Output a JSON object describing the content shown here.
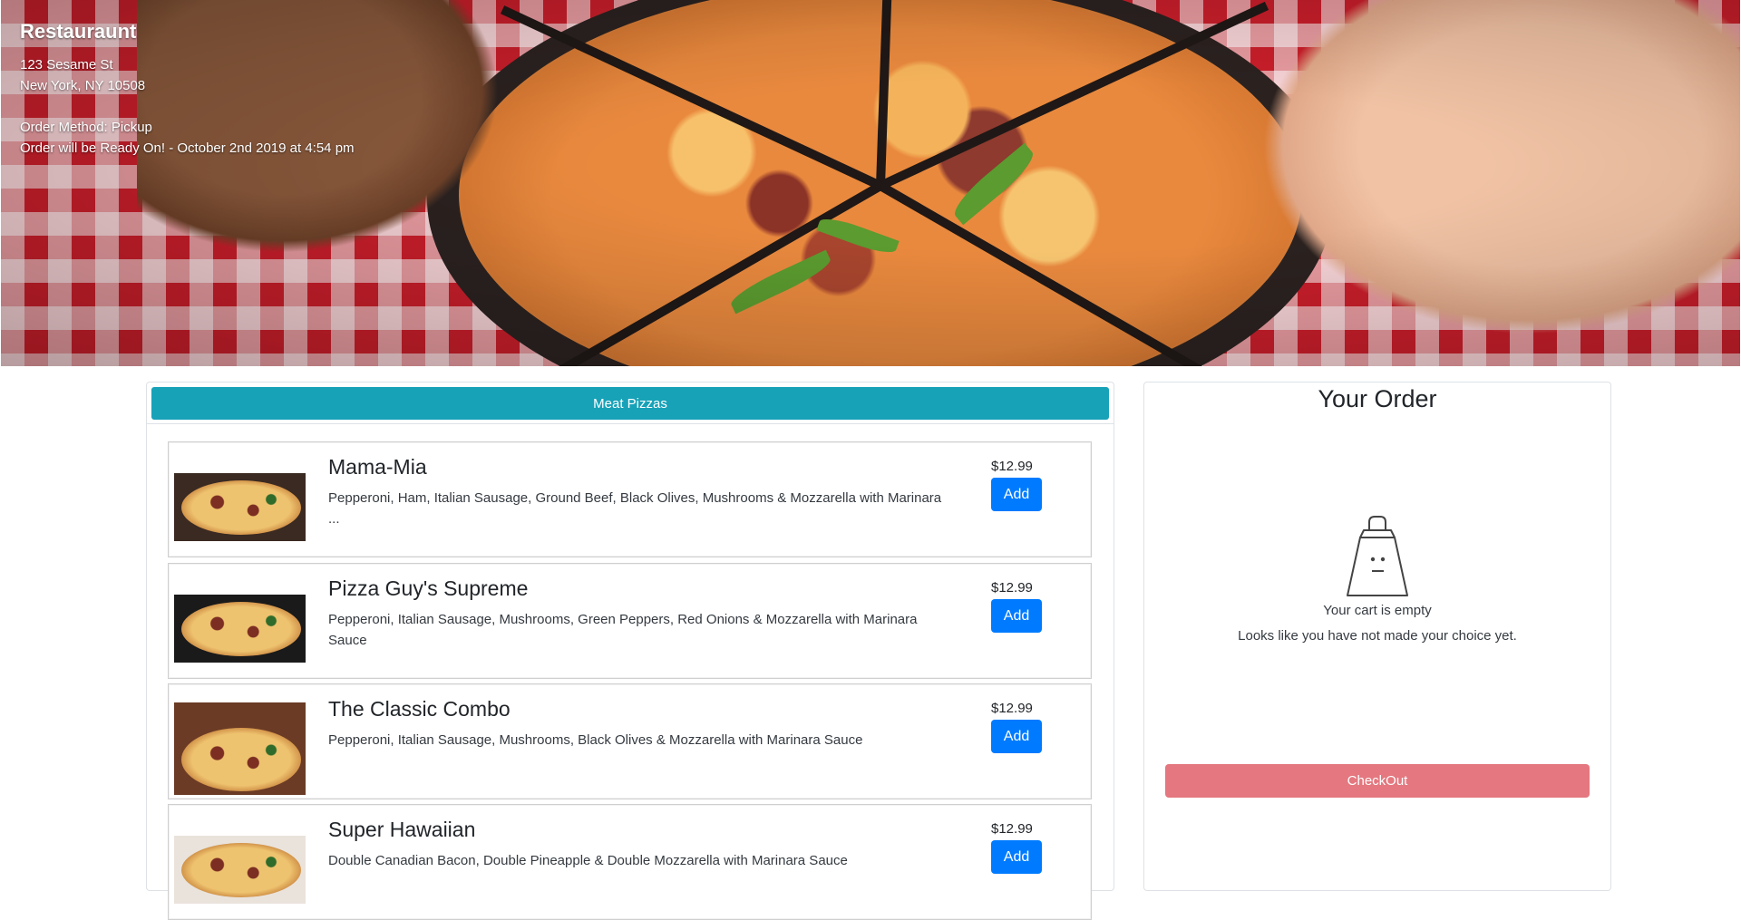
{
  "restaurant": {
    "name": "Restauraunt",
    "address_line1": "123 Sesame St",
    "address_line2": "New York, NY 10508",
    "order_method": "Order Method: Pickup",
    "ready_time": "Order will be Ready On! - October 2nd 2019 at 4:54 pm"
  },
  "menu": {
    "category": "Meat Pizzas",
    "items": [
      {
        "name": "Mama-Mia",
        "description": "Pepperoni, Ham, Italian Sausage, Ground Beef, Black Olives, Mushrooms & Mozzarella with Marinara ...",
        "price": "$12.99",
        "add_label": "Add"
      },
      {
        "name": "Pizza Guy's Supreme",
        "description": "Pepperoni, Italian Sausage, Mushrooms, Green Peppers, Red Onions & Mozzarella with Marinara Sauce",
        "price": "$12.99",
        "add_label": "Add"
      },
      {
        "name": "The Classic Combo",
        "description": "Pepperoni, Italian Sausage, Mushrooms, Black Olives & Mozzarella with Marinara Sauce",
        "price": "$12.99",
        "add_label": "Add"
      },
      {
        "name": "Super Hawaiian",
        "description": "Double Canadian Bacon, Double Pineapple & Double Mozzarella with Marinara Sauce",
        "price": "$12.99",
        "add_label": "Add"
      }
    ]
  },
  "order": {
    "title": "Your Order",
    "empty_title": "Your cart is empty",
    "empty_hint": "Looks like you have not made your choice yet.",
    "checkout_label": "CheckOut",
    "icon": "shopping-bag-icon"
  },
  "colors": {
    "category_bar": "#17a2b8",
    "add_button": "#007bff",
    "checkout_button": "#e4777f"
  }
}
